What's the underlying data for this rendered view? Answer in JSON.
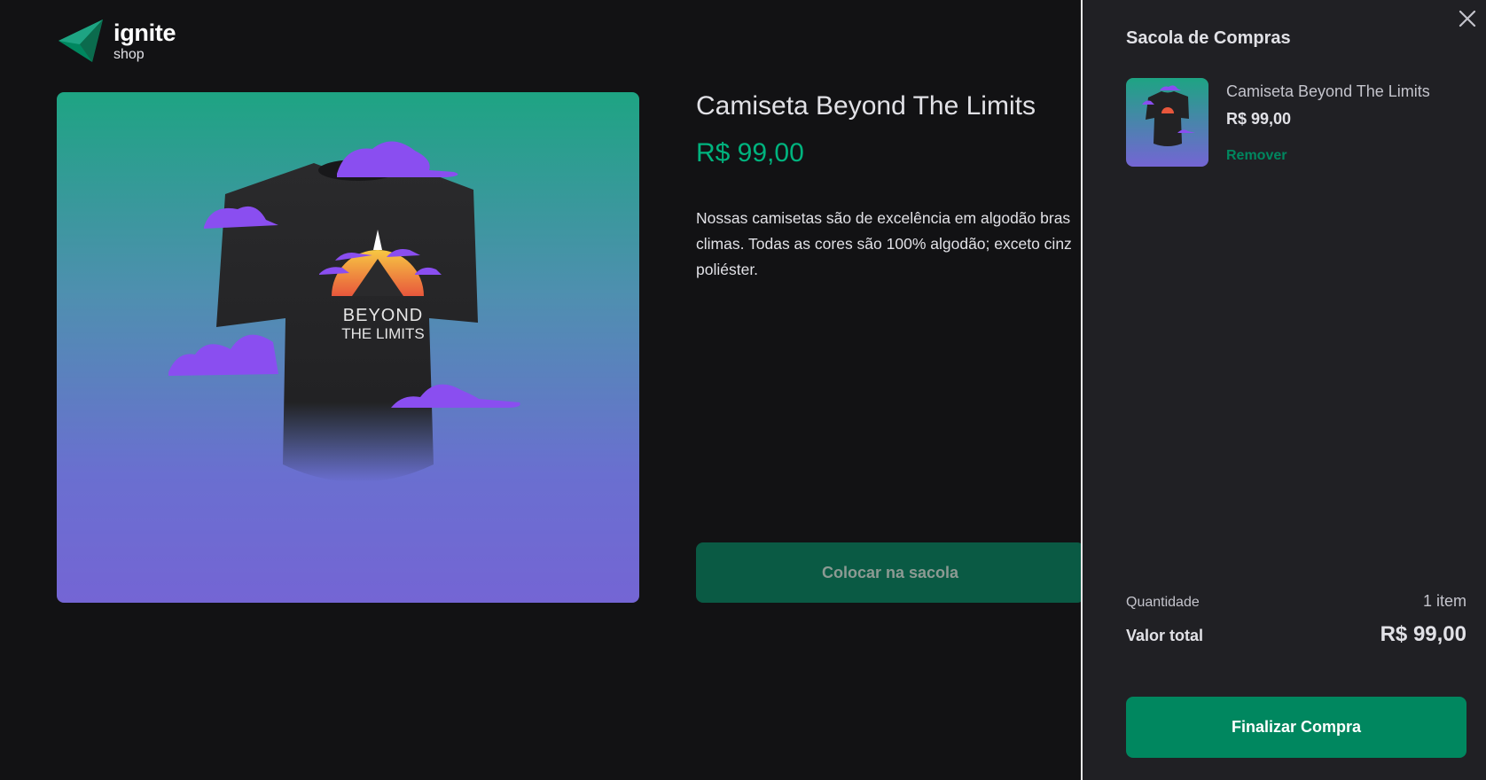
{
  "brand": {
    "name": "ignite",
    "subtitle": "shop"
  },
  "product": {
    "title": "Camiseta Beyond The Limits",
    "price": "R$ 99,00",
    "description": "Nossas camisetas são de excelência em algodão bras climas. Todas as cores são 100% algodão; exceto cinz poliéster.",
    "image_icon": "tshirt-with-clouds-image",
    "add_button_label": "Colocar na sacola"
  },
  "cart": {
    "title": "Sacola de Compras",
    "close_icon": "close-icon",
    "items": [
      {
        "name": "Camiseta Beyond The Limits",
        "price": "R$ 99,00",
        "remove_label": "Remover"
      }
    ],
    "quantity_label": "Quantidade",
    "quantity_value": "1 item",
    "total_label": "Valor total",
    "total_value": "R$ 99,00",
    "checkout_label": "Finalizar Compra"
  },
  "colors": {
    "background": "#121214",
    "drawer": "#202024",
    "accent": "#00875f",
    "price_green": "#00b37e",
    "gradient_top": "#1ea483",
    "gradient_bottom": "#7465d4"
  }
}
